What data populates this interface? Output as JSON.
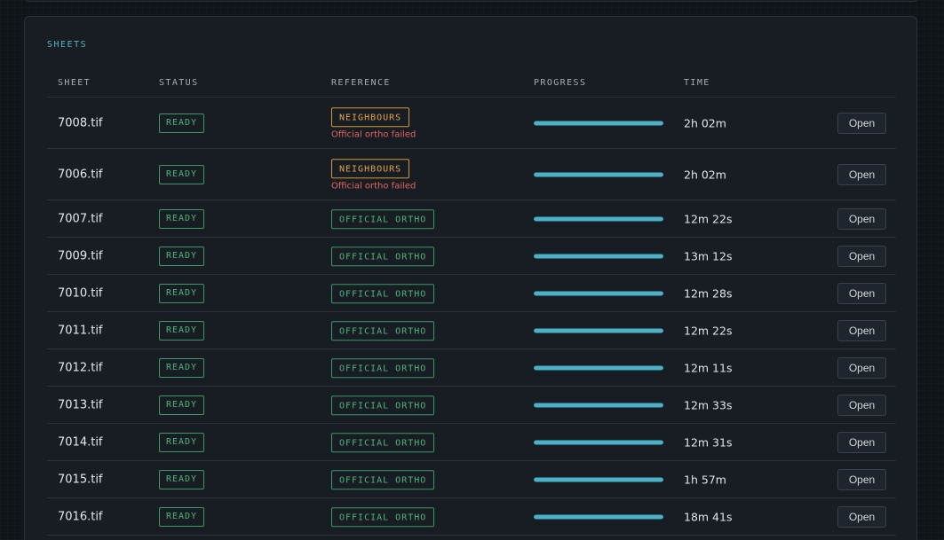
{
  "section": {
    "title": "SHEETS"
  },
  "columns": {
    "sheet": "SHEET",
    "status": "STATUS",
    "reference": "REFERENCE",
    "progress": "PROGRESS",
    "time": "TIME"
  },
  "colors": {
    "accent": "#4fb3c4",
    "ready": "#4eb57b",
    "warning": "#e3a64a",
    "error": "#e46560",
    "progress": "#4ab2c8"
  },
  "rows": [
    {
      "sheet": "7008.tif",
      "status": "READY",
      "reference": "NEIGHBOURS",
      "ref_kind": "warn",
      "note": "Official ortho failed",
      "progress": 1.0,
      "time": "2h 02m",
      "action": "Open"
    },
    {
      "sheet": "7006.tif",
      "status": "READY",
      "reference": "NEIGHBOURS",
      "ref_kind": "warn",
      "note": "Official ortho failed",
      "progress": 1.0,
      "time": "2h 02m",
      "action": "Open"
    },
    {
      "sheet": "7007.tif",
      "status": "READY",
      "reference": "OFFICIAL ORTHO",
      "ref_kind": "ok",
      "note": "",
      "progress": 1.0,
      "time": "12m 22s",
      "action": "Open"
    },
    {
      "sheet": "7009.tif",
      "status": "READY",
      "reference": "OFFICIAL ORTHO",
      "ref_kind": "ok",
      "note": "",
      "progress": 1.0,
      "time": "13m 12s",
      "action": "Open"
    },
    {
      "sheet": "7010.tif",
      "status": "READY",
      "reference": "OFFICIAL ORTHO",
      "ref_kind": "ok",
      "note": "",
      "progress": 1.0,
      "time": "12m 28s",
      "action": "Open"
    },
    {
      "sheet": "7011.tif",
      "status": "READY",
      "reference": "OFFICIAL ORTHO",
      "ref_kind": "ok",
      "note": "",
      "progress": 1.0,
      "time": "12m 22s",
      "action": "Open"
    },
    {
      "sheet": "7012.tif",
      "status": "READY",
      "reference": "OFFICIAL ORTHO",
      "ref_kind": "ok",
      "note": "",
      "progress": 1.0,
      "time": "12m 11s",
      "action": "Open"
    },
    {
      "sheet": "7013.tif",
      "status": "READY",
      "reference": "OFFICIAL ORTHO",
      "ref_kind": "ok",
      "note": "",
      "progress": 1.0,
      "time": "12m 33s",
      "action": "Open"
    },
    {
      "sheet": "7014.tif",
      "status": "READY",
      "reference": "OFFICIAL ORTHO",
      "ref_kind": "ok",
      "note": "",
      "progress": 1.0,
      "time": "12m 31s",
      "action": "Open"
    },
    {
      "sheet": "7015.tif",
      "status": "READY",
      "reference": "OFFICIAL ORTHO",
      "ref_kind": "ok",
      "note": "",
      "progress": 1.0,
      "time": "1h 57m",
      "action": "Open"
    },
    {
      "sheet": "7016.tif",
      "status": "READY",
      "reference": "OFFICIAL ORTHO",
      "ref_kind": "ok",
      "note": "",
      "progress": 1.0,
      "time": "18m 41s",
      "action": "Open"
    }
  ]
}
